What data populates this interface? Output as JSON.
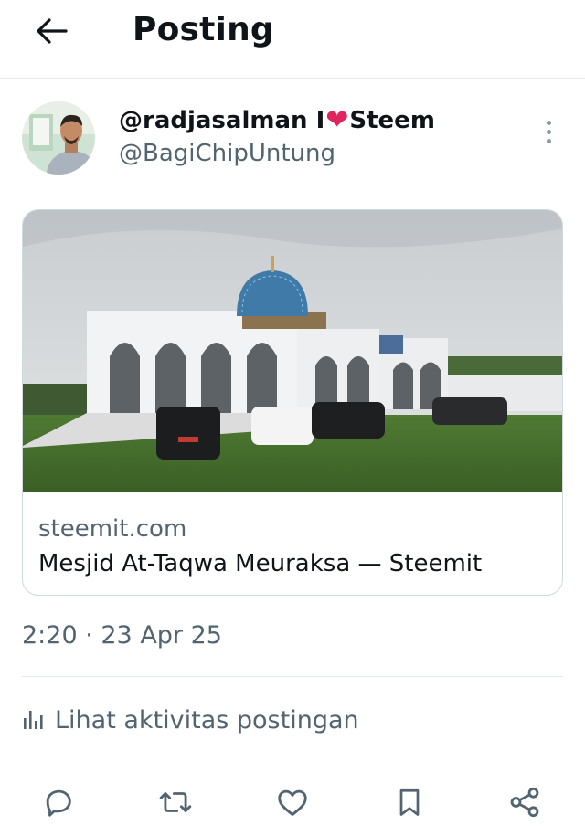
{
  "header": {
    "title": "Posting",
    "back_icon": "arrow-left-icon"
  },
  "author": {
    "display_name_prefix": "@radjasalman I",
    "display_name_emoji": "❤",
    "display_name_suffix": "Steem",
    "handle": "@BagiChipUntung",
    "more_icon": "more-vertical-icon"
  },
  "link_card": {
    "domain": "steemit.com",
    "title": "Mesjid At-Taqwa Meuraksa — Steemit"
  },
  "post": {
    "timestamp": "2:20 · 23 Apr 25"
  },
  "activity": {
    "label": "Lihat aktivitas postingan",
    "icon": "analytics-bars-icon"
  },
  "actions": {
    "reply_icon": "reply-icon",
    "repost_icon": "repost-icon",
    "like_icon": "heart-icon",
    "bookmark_icon": "bookmark-icon",
    "share_icon": "share-icon"
  },
  "colors": {
    "secondary_text": "#536471",
    "heart": "#e0245e",
    "border": "#cfd9de"
  }
}
